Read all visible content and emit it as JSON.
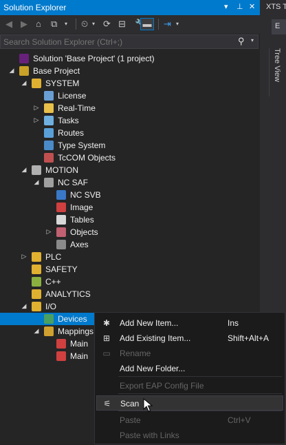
{
  "panel": {
    "title": "Solution Explorer",
    "title_buttons": [
      "▾",
      " ",
      "✕"
    ],
    "search_placeholder": "Search Solution Explorer (Ctrl+;)"
  },
  "right_panel": {
    "tab": "XTS T",
    "tree_view_label": "Tree View"
  },
  "tree": [
    {
      "label": "Solution 'Base Project' (1 project)",
      "level": 0,
      "exp": "",
      "color": "#68217a",
      "icon": "solution-icon"
    },
    {
      "label": "Base Project",
      "level": 0,
      "exp": "◢",
      "color": "#c9a227",
      "icon": "project-icon"
    },
    {
      "label": "SYSTEM",
      "level": 1,
      "exp": "◢",
      "color": "#e0b030",
      "icon": "system-icon"
    },
    {
      "label": "License",
      "level": 2,
      "exp": "",
      "color": "#6a9fd4",
      "icon": "license-icon"
    },
    {
      "label": "Real-Time",
      "level": 2,
      "exp": "▷",
      "color": "#e8c04a",
      "icon": "realtime-icon"
    },
    {
      "label": "Tasks",
      "level": 2,
      "exp": "▷",
      "color": "#6fb0e0",
      "icon": "tasks-icon"
    },
    {
      "label": "Routes",
      "level": 2,
      "exp": "",
      "color": "#5aa0d8",
      "icon": "routes-icon"
    },
    {
      "label": "Type System",
      "level": 2,
      "exp": "",
      "color": "#4a8ac8",
      "icon": "type-system-icon"
    },
    {
      "label": "TcCOM Objects",
      "level": 2,
      "exp": "",
      "color": "#c05050",
      "icon": "tccom-icon"
    },
    {
      "label": "MOTION",
      "level": 1,
      "exp": "◢",
      "color": "#b0b0b0",
      "icon": "motion-icon"
    },
    {
      "label": "NC SAF",
      "level": 2,
      "exp": "◢",
      "color": "#a0a0a0",
      "icon": "nc-saf-icon"
    },
    {
      "label": "NC SVB",
      "level": 3,
      "exp": "",
      "color": "#3a78c8",
      "icon": "nc-svb-icon"
    },
    {
      "label": "Image",
      "level": 3,
      "exp": "",
      "color": "#d04040",
      "icon": "image-icon"
    },
    {
      "label": "Tables",
      "level": 3,
      "exp": "",
      "color": "#d8d8d8",
      "icon": "tables-icon"
    },
    {
      "label": "Objects",
      "level": 3,
      "exp": "▷",
      "color": "#c06070",
      "icon": "objects-icon"
    },
    {
      "label": "Axes",
      "level": 3,
      "exp": "",
      "color": "#8a8a8a",
      "icon": "axes-icon"
    },
    {
      "label": "PLC",
      "level": 1,
      "exp": "▷",
      "color": "#e0b030",
      "icon": "plc-icon"
    },
    {
      "label": "SAFETY",
      "level": 1,
      "exp": "",
      "color": "#e0b030",
      "icon": "safety-icon"
    },
    {
      "label": "C++",
      "level": 1,
      "exp": "",
      "color": "#8ab040",
      "icon": "cpp-icon"
    },
    {
      "label": "ANALYTICS",
      "level": 1,
      "exp": "",
      "color": "#e0b030",
      "icon": "analytics-icon"
    },
    {
      "label": "I/O",
      "level": 1,
      "exp": "◢",
      "color": "#e0b030",
      "icon": "io-icon"
    },
    {
      "label": "Devices",
      "level": 2,
      "exp": "",
      "color": "#4aa060",
      "icon": "devices-icon",
      "selected": true
    },
    {
      "label": "Mappings",
      "level": 2,
      "exp": "◢",
      "color": "#d0a030",
      "icon": "mappings-icon"
    },
    {
      "label": "Main",
      "level": 3,
      "exp": "",
      "color": "#d04040",
      "icon": "main-icon"
    },
    {
      "label": "Main",
      "level": 3,
      "exp": "",
      "color": "#d04040",
      "icon": "main-icon"
    }
  ],
  "context_menu": [
    {
      "label": "Add New Item...",
      "shortcut": "Ins",
      "icon": "✱",
      "enabled": true
    },
    {
      "label": "Add Existing Item...",
      "shortcut": "Shift+Alt+A",
      "icon": "⊞",
      "enabled": true
    },
    {
      "label": "Rename",
      "shortcut": "",
      "icon": "▭",
      "enabled": false
    },
    {
      "label": "Add New Folder...",
      "shortcut": "",
      "icon": "",
      "enabled": true,
      "sep_after": true
    },
    {
      "label": "Export EAP Config File",
      "shortcut": "",
      "icon": "",
      "enabled": false,
      "sep_after": true
    },
    {
      "label": "Scan",
      "shortcut": "",
      "icon": "⚟",
      "enabled": true,
      "hover": true,
      "sep_after": true
    },
    {
      "label": "Paste",
      "shortcut": "Ctrl+V",
      "icon": "",
      "enabled": false
    },
    {
      "label": "Paste with Links",
      "shortcut": "",
      "icon": "",
      "enabled": false
    }
  ]
}
